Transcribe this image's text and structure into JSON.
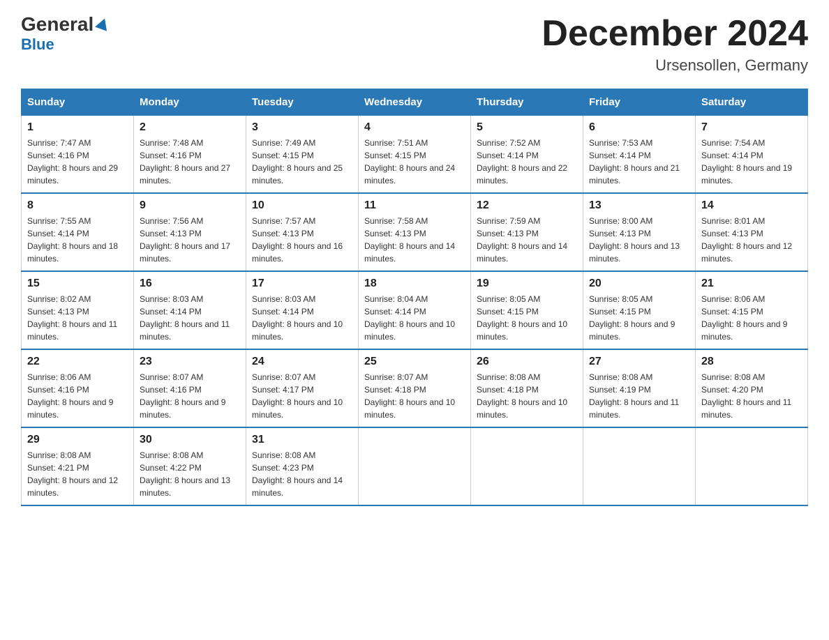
{
  "header": {
    "logo_line1": "General",
    "logo_line2": "Blue",
    "month_title": "December 2024",
    "location": "Ursensollen, Germany"
  },
  "columns": [
    "Sunday",
    "Monday",
    "Tuesday",
    "Wednesday",
    "Thursday",
    "Friday",
    "Saturday"
  ],
  "weeks": [
    [
      {
        "day": "1",
        "sunrise": "7:47 AM",
        "sunset": "4:16 PM",
        "daylight": "8 hours and 29 minutes."
      },
      {
        "day": "2",
        "sunrise": "7:48 AM",
        "sunset": "4:16 PM",
        "daylight": "8 hours and 27 minutes."
      },
      {
        "day": "3",
        "sunrise": "7:49 AM",
        "sunset": "4:15 PM",
        "daylight": "8 hours and 25 minutes."
      },
      {
        "day": "4",
        "sunrise": "7:51 AM",
        "sunset": "4:15 PM",
        "daylight": "8 hours and 24 minutes."
      },
      {
        "day": "5",
        "sunrise": "7:52 AM",
        "sunset": "4:14 PM",
        "daylight": "8 hours and 22 minutes."
      },
      {
        "day": "6",
        "sunrise": "7:53 AM",
        "sunset": "4:14 PM",
        "daylight": "8 hours and 21 minutes."
      },
      {
        "day": "7",
        "sunrise": "7:54 AM",
        "sunset": "4:14 PM",
        "daylight": "8 hours and 19 minutes."
      }
    ],
    [
      {
        "day": "8",
        "sunrise": "7:55 AM",
        "sunset": "4:14 PM",
        "daylight": "8 hours and 18 minutes."
      },
      {
        "day": "9",
        "sunrise": "7:56 AM",
        "sunset": "4:13 PM",
        "daylight": "8 hours and 17 minutes."
      },
      {
        "day": "10",
        "sunrise": "7:57 AM",
        "sunset": "4:13 PM",
        "daylight": "8 hours and 16 minutes."
      },
      {
        "day": "11",
        "sunrise": "7:58 AM",
        "sunset": "4:13 PM",
        "daylight": "8 hours and 14 minutes."
      },
      {
        "day": "12",
        "sunrise": "7:59 AM",
        "sunset": "4:13 PM",
        "daylight": "8 hours and 14 minutes."
      },
      {
        "day": "13",
        "sunrise": "8:00 AM",
        "sunset": "4:13 PM",
        "daylight": "8 hours and 13 minutes."
      },
      {
        "day": "14",
        "sunrise": "8:01 AM",
        "sunset": "4:13 PM",
        "daylight": "8 hours and 12 minutes."
      }
    ],
    [
      {
        "day": "15",
        "sunrise": "8:02 AM",
        "sunset": "4:13 PM",
        "daylight": "8 hours and 11 minutes."
      },
      {
        "day": "16",
        "sunrise": "8:03 AM",
        "sunset": "4:14 PM",
        "daylight": "8 hours and 11 minutes."
      },
      {
        "day": "17",
        "sunrise": "8:03 AM",
        "sunset": "4:14 PM",
        "daylight": "8 hours and 10 minutes."
      },
      {
        "day": "18",
        "sunrise": "8:04 AM",
        "sunset": "4:14 PM",
        "daylight": "8 hours and 10 minutes."
      },
      {
        "day": "19",
        "sunrise": "8:05 AM",
        "sunset": "4:15 PM",
        "daylight": "8 hours and 10 minutes."
      },
      {
        "day": "20",
        "sunrise": "8:05 AM",
        "sunset": "4:15 PM",
        "daylight": "8 hours and 9 minutes."
      },
      {
        "day": "21",
        "sunrise": "8:06 AM",
        "sunset": "4:15 PM",
        "daylight": "8 hours and 9 minutes."
      }
    ],
    [
      {
        "day": "22",
        "sunrise": "8:06 AM",
        "sunset": "4:16 PM",
        "daylight": "8 hours and 9 minutes."
      },
      {
        "day": "23",
        "sunrise": "8:07 AM",
        "sunset": "4:16 PM",
        "daylight": "8 hours and 9 minutes."
      },
      {
        "day": "24",
        "sunrise": "8:07 AM",
        "sunset": "4:17 PM",
        "daylight": "8 hours and 10 minutes."
      },
      {
        "day": "25",
        "sunrise": "8:07 AM",
        "sunset": "4:18 PM",
        "daylight": "8 hours and 10 minutes."
      },
      {
        "day": "26",
        "sunrise": "8:08 AM",
        "sunset": "4:18 PM",
        "daylight": "8 hours and 10 minutes."
      },
      {
        "day": "27",
        "sunrise": "8:08 AM",
        "sunset": "4:19 PM",
        "daylight": "8 hours and 11 minutes."
      },
      {
        "day": "28",
        "sunrise": "8:08 AM",
        "sunset": "4:20 PM",
        "daylight": "8 hours and 11 minutes."
      }
    ],
    [
      {
        "day": "29",
        "sunrise": "8:08 AM",
        "sunset": "4:21 PM",
        "daylight": "8 hours and 12 minutes."
      },
      {
        "day": "30",
        "sunrise": "8:08 AM",
        "sunset": "4:22 PM",
        "daylight": "8 hours and 13 minutes."
      },
      {
        "day": "31",
        "sunrise": "8:08 AM",
        "sunset": "4:23 PM",
        "daylight": "8 hours and 14 minutes."
      },
      null,
      null,
      null,
      null
    ]
  ]
}
